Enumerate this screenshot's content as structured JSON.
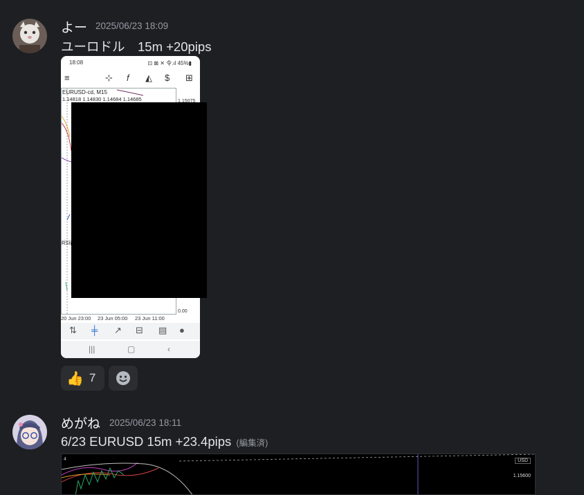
{
  "messages": [
    {
      "author": "よー",
      "timestamp": "2025/06/23 18:09",
      "text": "ユーロドル　15m +20pips",
      "attachment": {
        "status_time": "18:08",
        "status_right": "⊡ ⊠ ✕ 令.ıl 45%▮",
        "toolbar_icons": [
          "menu-icon",
          "crosshair-icon",
          "indicator-f-icon",
          "objects-icon",
          "currency-icon",
          "new-order-icon"
        ],
        "symbol_label": "EURUSD-cd, M15",
        "ohlc_label": "1.14818 1.14830 1.14684 1.14685",
        "price_top": "1.15075",
        "indicator_label": "RSI(",
        "price_bottom": "0.00",
        "x_labels": [
          "20 Jun 23:00",
          "23 Jun 05:00",
          "23 Jun 11:00"
        ],
        "bottom_tabs": [
          "quotes-icon",
          "chart-icon",
          "trade-icon",
          "history-icon",
          "news-icon",
          "messages-icon"
        ],
        "nav": [
          "|||",
          "▢",
          "‹"
        ]
      },
      "reactions": [
        {
          "emoji": "👍",
          "count": "7"
        },
        {
          "emoji": "add-reaction-icon",
          "count": ""
        }
      ]
    },
    {
      "author": "めがね",
      "timestamp": "2025/06/23 18:11",
      "text": "6/23 EURUSD 15m  +23.4pips",
      "edited": "(編集済)",
      "attachment": {
        "timeframe": "4",
        "currency": "USD",
        "price": "1.15600"
      }
    }
  ],
  "colors": {
    "background": "#1e1f22",
    "muted_text": "#949ba4",
    "reaction_bg": "#2b2d31",
    "redaction": "#000000"
  }
}
